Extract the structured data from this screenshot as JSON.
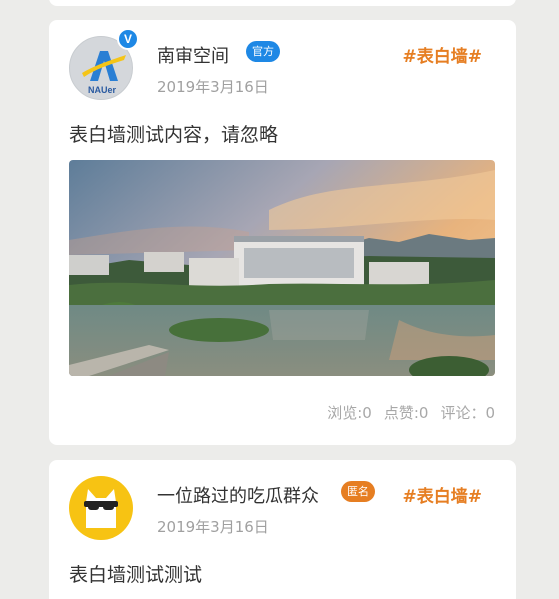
{
  "posts": [
    {
      "user_name": "南审空间",
      "tag": "官方",
      "verified_mark": "V",
      "avatar_text": "NAUer",
      "topic": "#表白墙#",
      "date": "2019年3月16日",
      "content": "表白墙测试内容，请忽略",
      "stats": {
        "views": "浏览:0",
        "likes": "点赞:0",
        "comments": "评论：0"
      }
    },
    {
      "user_name": "一位路过的吃瓜群众",
      "tag": "匿名",
      "topic": "#表白墙#",
      "date": "2019年3月16日",
      "content": "表白墙测试测试"
    }
  ],
  "colors": {
    "accent_orange": "#e67e22",
    "official_blue": "#1e88e5",
    "anon_avatar_yellow": "#f7c313"
  }
}
